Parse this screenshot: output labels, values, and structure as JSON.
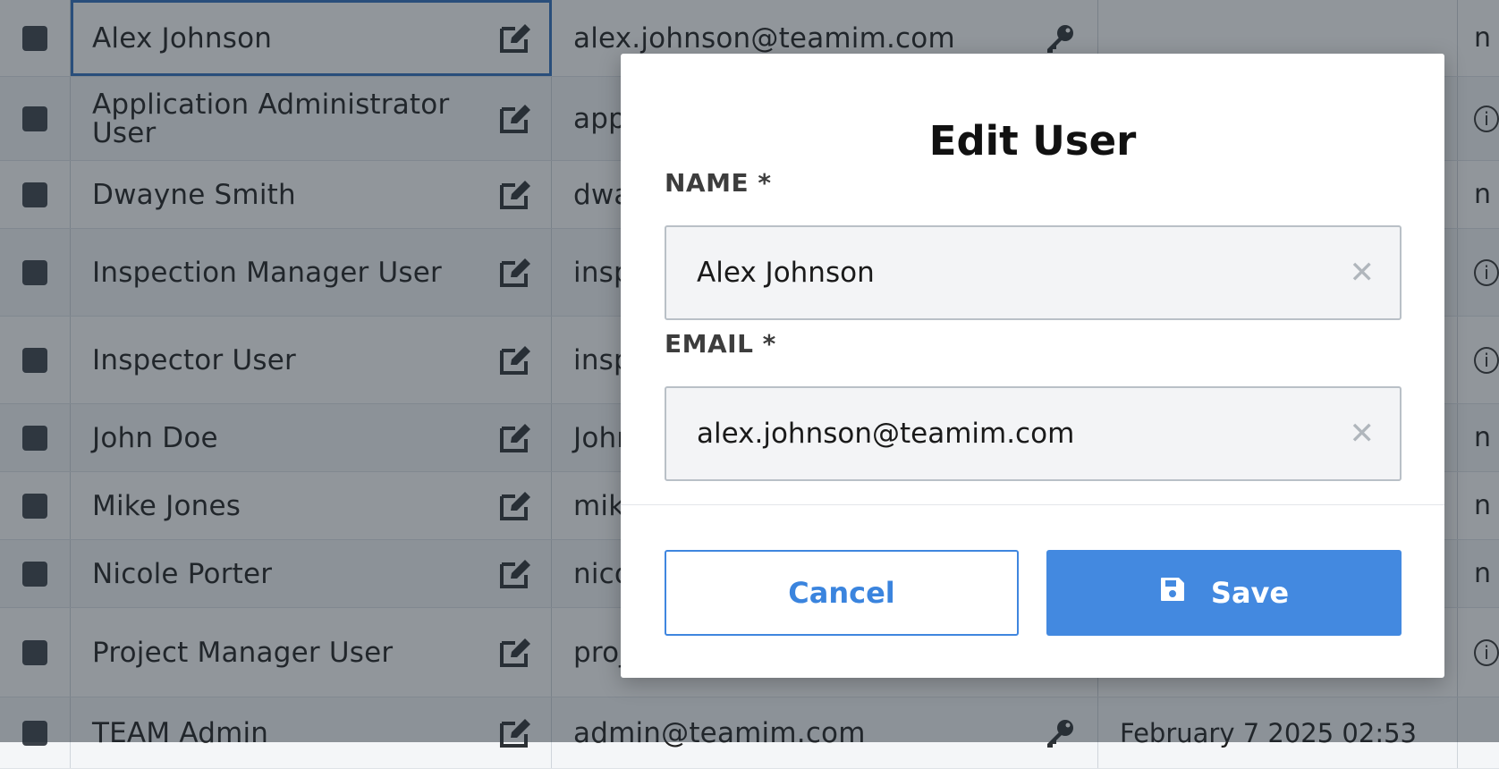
{
  "table": {
    "rows": [
      {
        "name": "Alex Johnson",
        "email": "alex.johnson@teamim.com",
        "date": "",
        "last": "n",
        "has_key": true,
        "selected": true
      },
      {
        "name": "Application Administrator User",
        "email": "app",
        "date": "",
        "last": "info",
        "has_key": false
      },
      {
        "name": "Dwayne Smith",
        "email": "dwa",
        "date": "",
        "last": "n",
        "has_key": false
      },
      {
        "name": "Inspection Manager User",
        "email": "insp",
        "date": "",
        "last": "info",
        "has_key": false
      },
      {
        "name": "Inspector User",
        "email": "insp",
        "date": "",
        "last": "info",
        "has_key": false
      },
      {
        "name": "John Doe",
        "email": "John",
        "date": "",
        "last": "n",
        "has_key": false
      },
      {
        "name": "Mike Jones",
        "email": "mik",
        "date": "",
        "last": "n",
        "has_key": false
      },
      {
        "name": "Nicole Porter",
        "email": "nico",
        "date": "",
        "last": "n",
        "has_key": false
      },
      {
        "name": "Project Manager User",
        "email": "proj",
        "date": "",
        "last": "info",
        "has_key": false
      },
      {
        "name": "TEAM Admin",
        "email": "admin@teamim.com",
        "date": "February 7 2025 02:53",
        "last": "",
        "has_key": true
      }
    ]
  },
  "modal": {
    "title": "Edit User",
    "name_label": "NAME *",
    "name_value": "Alex Johnson",
    "email_label": "EMAIL *",
    "email_value": "alex.johnson@teamim.com",
    "cancel_label": "Cancel",
    "save_label": "Save"
  },
  "colors": {
    "accent": "#4389e0",
    "overlay": "rgba(35,45,55,0.5)",
    "checkbox": "#3b4149"
  },
  "icons": {
    "edit": "edit-icon",
    "key": "key-icon",
    "clear": "clear-icon",
    "save": "floppy-disk-icon"
  }
}
